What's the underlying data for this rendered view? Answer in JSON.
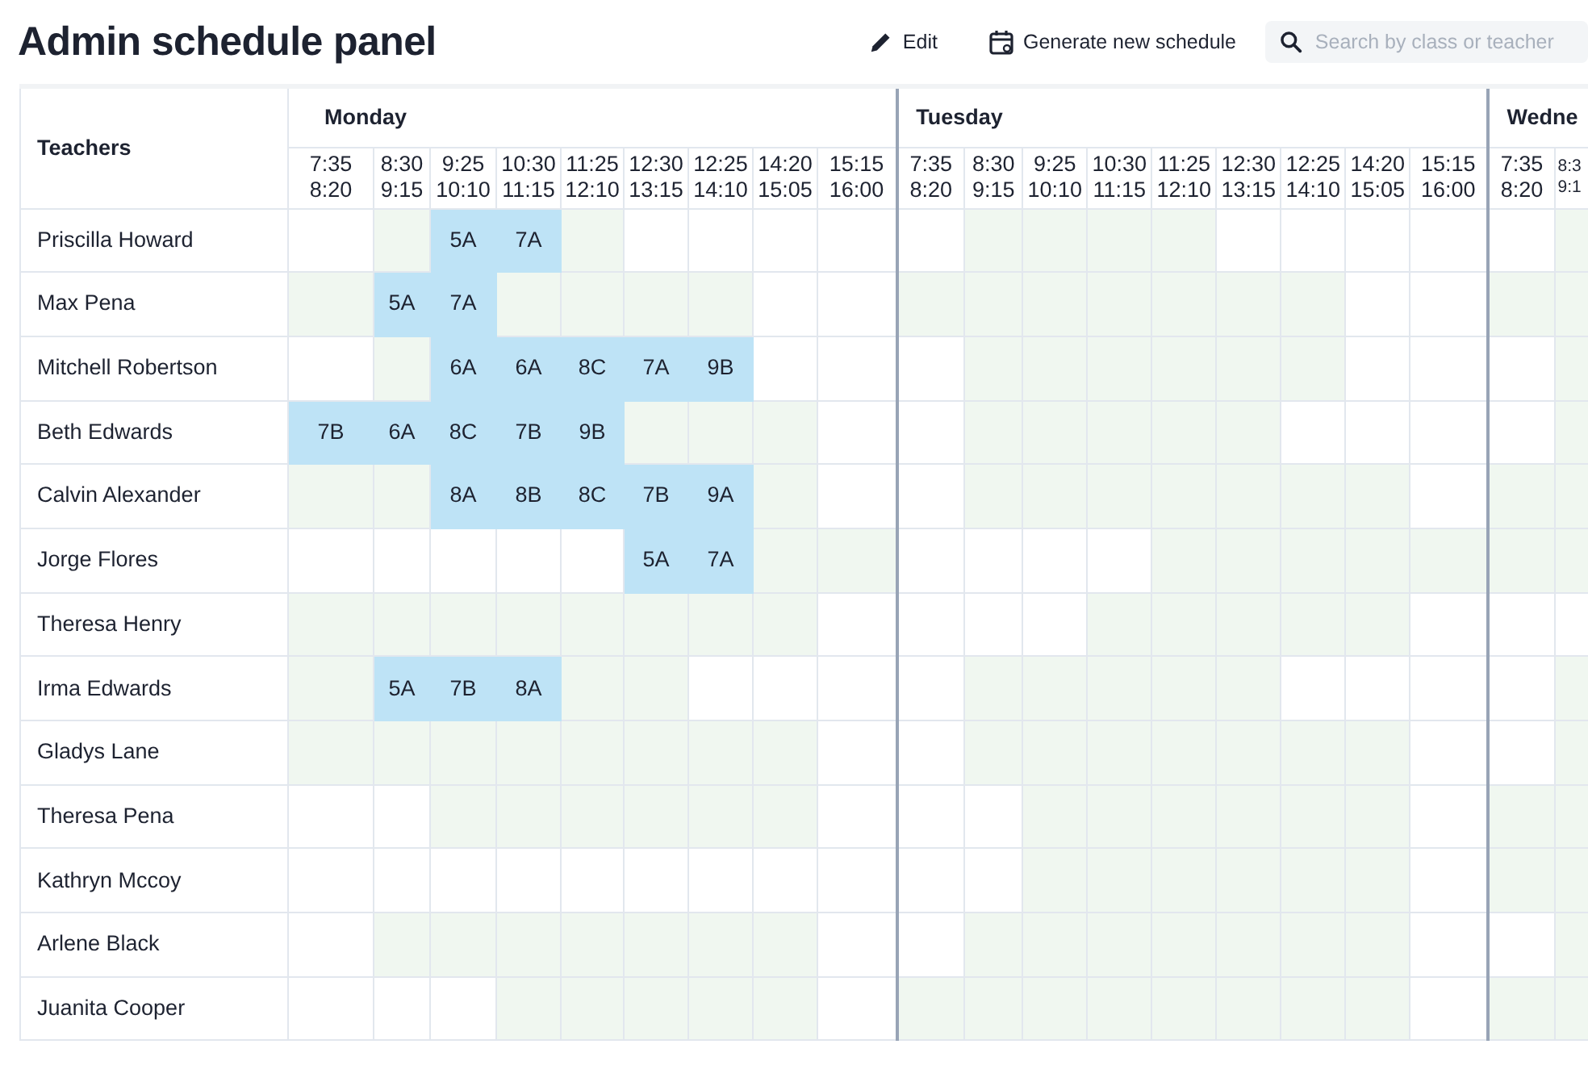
{
  "title": "Admin schedule panel",
  "actions": [
    {
      "kind": "edit",
      "label": "Edit"
    },
    {
      "kind": "generate",
      "label": "Generate new schedule"
    }
  ],
  "search": {
    "placeholder": "Search by class or teacher"
  },
  "teachers_heading": "Teachers",
  "days": [
    {
      "label": "Monday",
      "times": [
        [
          "7:35",
          "8:20"
        ],
        [
          "8:30",
          "9:15"
        ],
        [
          "9:25",
          "10:10"
        ],
        [
          "10:30",
          "11:15"
        ],
        [
          "11:25",
          "12:10"
        ],
        [
          "12:30",
          "13:15"
        ],
        [
          "12:25",
          "14:10"
        ],
        [
          "14:20",
          "15:05"
        ],
        [
          "15:15",
          "16:00"
        ]
      ]
    },
    {
      "label": "Tuesday",
      "times": [
        [
          "7:35",
          "8:20"
        ],
        [
          "8:30",
          "9:15"
        ],
        [
          "9:25",
          "10:10"
        ],
        [
          "10:30",
          "11:15"
        ],
        [
          "11:25",
          "12:10"
        ],
        [
          "12:30",
          "13:15"
        ],
        [
          "12:25",
          "14:10"
        ],
        [
          "14:20",
          "15:05"
        ],
        [
          "15:15",
          "16:00"
        ]
      ]
    },
    {
      "label": "Wedne",
      "times": [
        [
          "7:35",
          "8:20"
        ],
        [
          "8:3",
          "9:1"
        ]
      ]
    }
  ],
  "rows": [
    {
      "name": "Priscilla Howard",
      "days": [
        [
          {
            "kind": "blank"
          },
          {
            "kind": "shaded"
          },
          {
            "kind": "lesson",
            "class": "5A"
          },
          {
            "kind": "lesson",
            "class": "7A"
          },
          {
            "kind": "shaded"
          },
          {
            "kind": "blank"
          },
          {
            "kind": "blank"
          },
          {
            "kind": "blank"
          },
          {
            "kind": "blank"
          }
        ],
        [
          {
            "kind": "blank"
          },
          {
            "kind": "shaded"
          },
          {
            "kind": "shaded"
          },
          {
            "kind": "shaded"
          },
          {
            "kind": "shaded"
          },
          {
            "kind": "blank"
          },
          {
            "kind": "blank"
          },
          {
            "kind": "blank"
          },
          {
            "kind": "blank"
          }
        ],
        [
          {
            "kind": "blank"
          },
          {
            "kind": "shaded"
          }
        ]
      ]
    },
    {
      "name": "Max Pena",
      "days": [
        [
          {
            "kind": "shaded"
          },
          {
            "kind": "lesson",
            "class": "5A"
          },
          {
            "kind": "lesson",
            "class": "7A"
          },
          {
            "kind": "shaded"
          },
          {
            "kind": "shaded"
          },
          {
            "kind": "shaded"
          },
          {
            "kind": "shaded"
          },
          {
            "kind": "blank"
          },
          {
            "kind": "blank"
          }
        ],
        [
          {
            "kind": "shaded"
          },
          {
            "kind": "shaded"
          },
          {
            "kind": "shaded"
          },
          {
            "kind": "shaded"
          },
          {
            "kind": "shaded"
          },
          {
            "kind": "shaded"
          },
          {
            "kind": "shaded"
          },
          {
            "kind": "blank"
          },
          {
            "kind": "blank"
          }
        ],
        [
          {
            "kind": "shaded"
          },
          {
            "kind": "shaded"
          }
        ]
      ]
    },
    {
      "name": "Mitchell Robertson",
      "days": [
        [
          {
            "kind": "blank"
          },
          {
            "kind": "shaded"
          },
          {
            "kind": "lesson",
            "class": "6A"
          },
          {
            "kind": "lesson",
            "class": "6A"
          },
          {
            "kind": "lesson",
            "class": "8C"
          },
          {
            "kind": "lesson",
            "class": "7A"
          },
          {
            "kind": "lesson",
            "class": "9B"
          },
          {
            "kind": "blank"
          },
          {
            "kind": "blank"
          }
        ],
        [
          {
            "kind": "blank"
          },
          {
            "kind": "shaded"
          },
          {
            "kind": "shaded"
          },
          {
            "kind": "shaded"
          },
          {
            "kind": "shaded"
          },
          {
            "kind": "shaded"
          },
          {
            "kind": "shaded"
          },
          {
            "kind": "blank"
          },
          {
            "kind": "blank"
          }
        ],
        [
          {
            "kind": "blank"
          },
          {
            "kind": "shaded"
          }
        ]
      ]
    },
    {
      "name": "Beth Edwards",
      "days": [
        [
          {
            "kind": "lesson",
            "class": "7B"
          },
          {
            "kind": "lesson",
            "class": "6A"
          },
          {
            "kind": "lesson",
            "class": "8C"
          },
          {
            "kind": "lesson",
            "class": "7B"
          },
          {
            "kind": "lesson",
            "class": "9B"
          },
          {
            "kind": "shaded"
          },
          {
            "kind": "shaded"
          },
          {
            "kind": "shaded"
          },
          {
            "kind": "blank"
          }
        ],
        [
          {
            "kind": "blank"
          },
          {
            "kind": "shaded"
          },
          {
            "kind": "shaded"
          },
          {
            "kind": "shaded"
          },
          {
            "kind": "shaded"
          },
          {
            "kind": "shaded"
          },
          {
            "kind": "blank"
          },
          {
            "kind": "blank"
          },
          {
            "kind": "blank"
          }
        ],
        [
          {
            "kind": "blank"
          },
          {
            "kind": "shaded"
          }
        ]
      ]
    },
    {
      "name": "Calvin Alexander",
      "days": [
        [
          {
            "kind": "shaded"
          },
          {
            "kind": "shaded"
          },
          {
            "kind": "lesson",
            "class": "8A"
          },
          {
            "kind": "lesson",
            "class": "8B"
          },
          {
            "kind": "lesson",
            "class": "8C"
          },
          {
            "kind": "lesson",
            "class": "7B"
          },
          {
            "kind": "lesson",
            "class": "9A"
          },
          {
            "kind": "shaded"
          },
          {
            "kind": "blank"
          }
        ],
        [
          {
            "kind": "blank"
          },
          {
            "kind": "shaded"
          },
          {
            "kind": "shaded"
          },
          {
            "kind": "shaded"
          },
          {
            "kind": "shaded"
          },
          {
            "kind": "shaded"
          },
          {
            "kind": "shaded"
          },
          {
            "kind": "shaded"
          },
          {
            "kind": "blank"
          }
        ],
        [
          {
            "kind": "shaded"
          },
          {
            "kind": "shaded"
          }
        ]
      ]
    },
    {
      "name": "Jorge Flores",
      "days": [
        [
          {
            "kind": "blank"
          },
          {
            "kind": "blank"
          },
          {
            "kind": "blank"
          },
          {
            "kind": "blank"
          },
          {
            "kind": "blank"
          },
          {
            "kind": "lesson",
            "class": "5A"
          },
          {
            "kind": "lesson",
            "class": "7A"
          },
          {
            "kind": "shaded"
          },
          {
            "kind": "shaded"
          }
        ],
        [
          {
            "kind": "blank"
          },
          {
            "kind": "blank"
          },
          {
            "kind": "blank"
          },
          {
            "kind": "blank"
          },
          {
            "kind": "shaded"
          },
          {
            "kind": "shaded"
          },
          {
            "kind": "shaded"
          },
          {
            "kind": "shaded"
          },
          {
            "kind": "shaded"
          }
        ],
        [
          {
            "kind": "shaded"
          },
          {
            "kind": "shaded"
          }
        ]
      ]
    },
    {
      "name": "Theresa Henry",
      "days": [
        [
          {
            "kind": "shaded"
          },
          {
            "kind": "shaded"
          },
          {
            "kind": "shaded"
          },
          {
            "kind": "shaded"
          },
          {
            "kind": "shaded"
          },
          {
            "kind": "shaded"
          },
          {
            "kind": "shaded"
          },
          {
            "kind": "shaded"
          },
          {
            "kind": "blank"
          }
        ],
        [
          {
            "kind": "blank"
          },
          {
            "kind": "blank"
          },
          {
            "kind": "blank"
          },
          {
            "kind": "shaded"
          },
          {
            "kind": "shaded"
          },
          {
            "kind": "shaded"
          },
          {
            "kind": "shaded"
          },
          {
            "kind": "shaded"
          },
          {
            "kind": "blank"
          }
        ],
        [
          {
            "kind": "blank"
          },
          {
            "kind": "blank"
          }
        ]
      ]
    },
    {
      "name": "Irma Edwards",
      "days": [
        [
          {
            "kind": "shaded"
          },
          {
            "kind": "lesson",
            "class": "5A"
          },
          {
            "kind": "lesson",
            "class": "7B"
          },
          {
            "kind": "lesson",
            "class": "8A"
          },
          {
            "kind": "shaded"
          },
          {
            "kind": "shaded"
          },
          {
            "kind": "blank"
          },
          {
            "kind": "blank"
          },
          {
            "kind": "blank"
          }
        ],
        [
          {
            "kind": "blank"
          },
          {
            "kind": "shaded"
          },
          {
            "kind": "shaded"
          },
          {
            "kind": "shaded"
          },
          {
            "kind": "shaded"
          },
          {
            "kind": "shaded"
          },
          {
            "kind": "blank"
          },
          {
            "kind": "blank"
          },
          {
            "kind": "blank"
          }
        ],
        [
          {
            "kind": "blank"
          },
          {
            "kind": "shaded"
          }
        ]
      ]
    },
    {
      "name": "Gladys Lane",
      "days": [
        [
          {
            "kind": "shaded"
          },
          {
            "kind": "shaded"
          },
          {
            "kind": "shaded"
          },
          {
            "kind": "shaded"
          },
          {
            "kind": "shaded"
          },
          {
            "kind": "shaded"
          },
          {
            "kind": "shaded"
          },
          {
            "kind": "shaded"
          },
          {
            "kind": "blank"
          }
        ],
        [
          {
            "kind": "blank"
          },
          {
            "kind": "shaded"
          },
          {
            "kind": "shaded"
          },
          {
            "kind": "shaded"
          },
          {
            "kind": "shaded"
          },
          {
            "kind": "shaded"
          },
          {
            "kind": "shaded"
          },
          {
            "kind": "shaded"
          },
          {
            "kind": "blank"
          }
        ],
        [
          {
            "kind": "blank"
          },
          {
            "kind": "shaded"
          }
        ]
      ]
    },
    {
      "name": "Theresa Pena",
      "days": [
        [
          {
            "kind": "blank"
          },
          {
            "kind": "blank"
          },
          {
            "kind": "shaded"
          },
          {
            "kind": "shaded"
          },
          {
            "kind": "shaded"
          },
          {
            "kind": "shaded"
          },
          {
            "kind": "shaded"
          },
          {
            "kind": "shaded"
          },
          {
            "kind": "blank"
          }
        ],
        [
          {
            "kind": "blank"
          },
          {
            "kind": "blank"
          },
          {
            "kind": "shaded"
          },
          {
            "kind": "shaded"
          },
          {
            "kind": "shaded"
          },
          {
            "kind": "shaded"
          },
          {
            "kind": "shaded"
          },
          {
            "kind": "shaded"
          },
          {
            "kind": "blank"
          }
        ],
        [
          {
            "kind": "shaded"
          },
          {
            "kind": "shaded"
          }
        ]
      ]
    },
    {
      "name": "Kathryn Mccoy",
      "days": [
        [
          {
            "kind": "blank"
          },
          {
            "kind": "blank"
          },
          {
            "kind": "blank"
          },
          {
            "kind": "blank"
          },
          {
            "kind": "blank"
          },
          {
            "kind": "blank"
          },
          {
            "kind": "blank"
          },
          {
            "kind": "blank"
          },
          {
            "kind": "blank"
          }
        ],
        [
          {
            "kind": "blank"
          },
          {
            "kind": "blank"
          },
          {
            "kind": "shaded"
          },
          {
            "kind": "shaded"
          },
          {
            "kind": "shaded"
          },
          {
            "kind": "shaded"
          },
          {
            "kind": "shaded"
          },
          {
            "kind": "shaded"
          },
          {
            "kind": "blank"
          }
        ],
        [
          {
            "kind": "shaded"
          },
          {
            "kind": "shaded"
          }
        ]
      ]
    },
    {
      "name": "Arlene Black",
      "days": [
        [
          {
            "kind": "blank"
          },
          {
            "kind": "shaded"
          },
          {
            "kind": "shaded"
          },
          {
            "kind": "shaded"
          },
          {
            "kind": "shaded"
          },
          {
            "kind": "shaded"
          },
          {
            "kind": "shaded"
          },
          {
            "kind": "shaded"
          },
          {
            "kind": "blank"
          }
        ],
        [
          {
            "kind": "blank"
          },
          {
            "kind": "shaded"
          },
          {
            "kind": "shaded"
          },
          {
            "kind": "shaded"
          },
          {
            "kind": "shaded"
          },
          {
            "kind": "shaded"
          },
          {
            "kind": "shaded"
          },
          {
            "kind": "shaded"
          },
          {
            "kind": "blank"
          }
        ],
        [
          {
            "kind": "blank"
          },
          {
            "kind": "shaded"
          }
        ]
      ]
    },
    {
      "name": "Juanita Cooper",
      "days": [
        [
          {
            "kind": "blank"
          },
          {
            "kind": "blank"
          },
          {
            "kind": "blank"
          },
          {
            "kind": "shaded"
          },
          {
            "kind": "shaded"
          },
          {
            "kind": "shaded"
          },
          {
            "kind": "shaded"
          },
          {
            "kind": "shaded"
          },
          {
            "kind": "blank"
          }
        ],
        [
          {
            "kind": "shaded"
          },
          {
            "kind": "shaded"
          },
          {
            "kind": "shaded"
          },
          {
            "kind": "shaded"
          },
          {
            "kind": "shaded"
          },
          {
            "kind": "shaded"
          },
          {
            "kind": "shaded"
          },
          {
            "kind": "shaded"
          },
          {
            "kind": "blank"
          }
        ],
        [
          {
            "kind": "shaded"
          },
          {
            "kind": "shaded"
          }
        ]
      ]
    }
  ]
}
